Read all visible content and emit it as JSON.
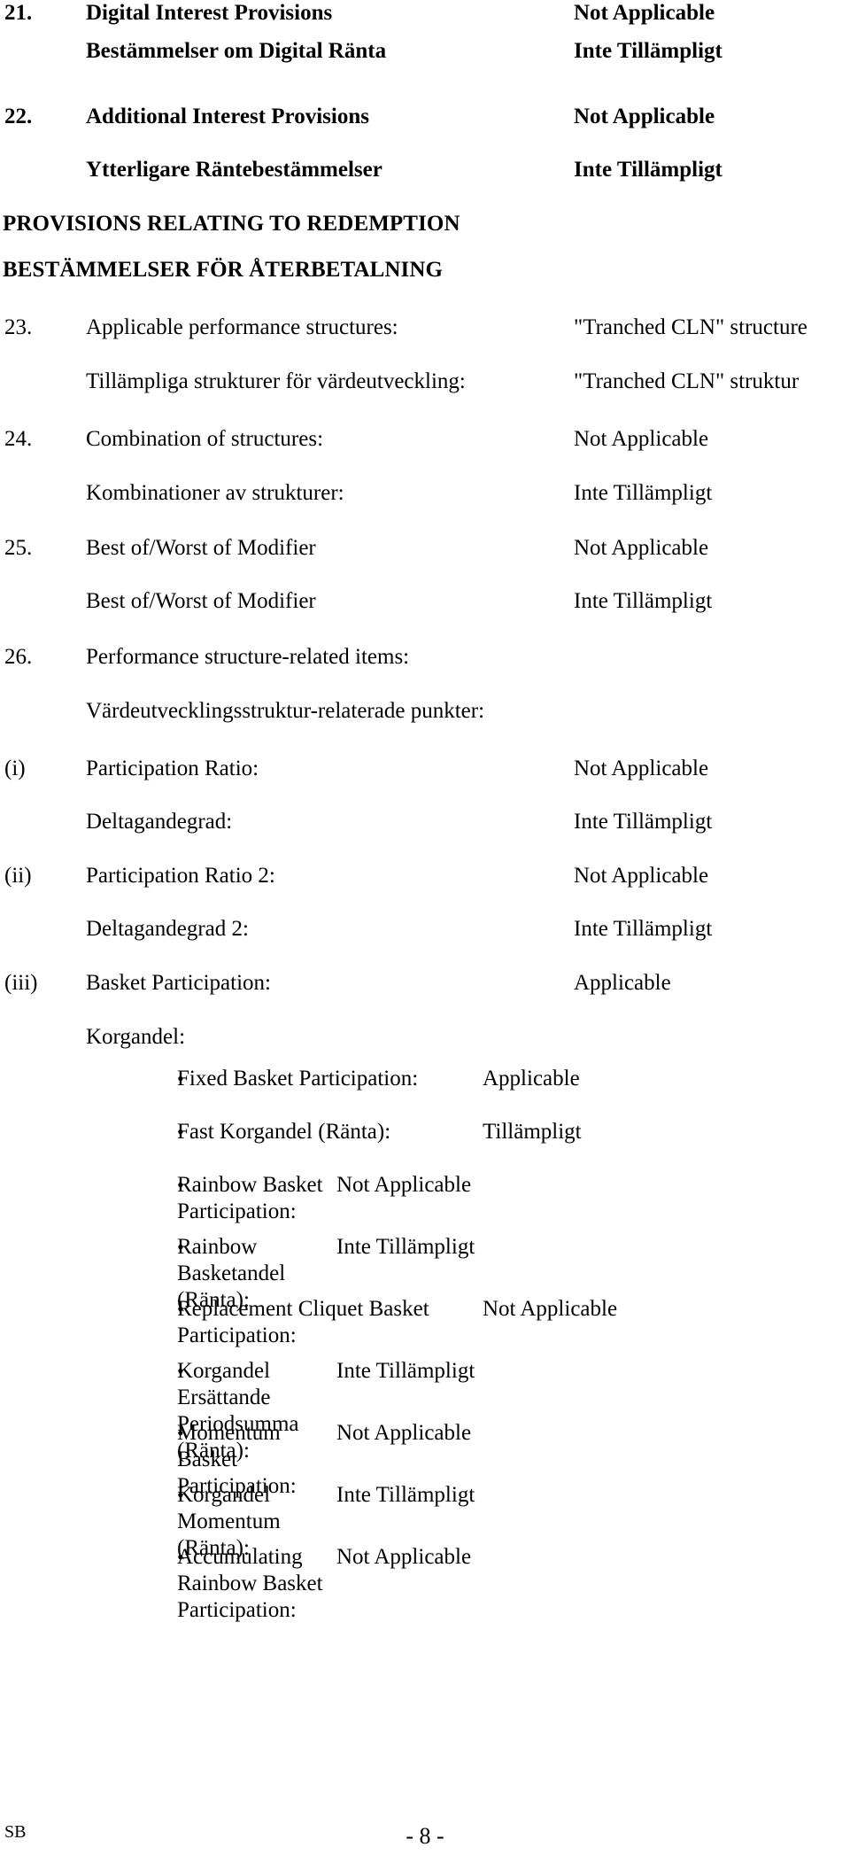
{
  "document": {
    "sections": [
      {
        "number": "21.",
        "label_en": "Digital Interest Provisions",
        "value_en": "Not Applicable",
        "label_sv": "Bestämmelser om Digital Ränta",
        "value_sv": "Inte Tillämpligt"
      },
      {
        "number": "22.",
        "label_en": "Additional Interest Provisions",
        "value_en": "Not Applicable",
        "label_sv": "Ytterligare Räntebestämmelser",
        "value_sv": "Inte Tillämpligt"
      }
    ],
    "headings": {
      "en": "PROVISIONS RELATING TO REDEMPTION",
      "sv": "BESTÄMMELSER FÖR ÅTERBETALNING"
    },
    "items": [
      {
        "number": "23.",
        "label_en": "Applicable performance structures:",
        "value_en": "\"Tranched CLN\" structure",
        "label_sv": "Tillämpliga strukturer för värdeutveckling:",
        "value_sv": "\"Tranched CLN\" struktur"
      },
      {
        "number": "24.",
        "label_en": "Combination of structures:",
        "value_en": "Not Applicable",
        "label_sv": "Kombinationer av strukturer:",
        "value_sv": "Inte Tillämpligt"
      },
      {
        "number": "25.",
        "label_en": "Best of/Worst of Modifier",
        "value_en": "Not Applicable",
        "label_sv": "Best of/Worst of Modifier",
        "value_sv": "Inte Tillämpligt"
      },
      {
        "number": "26.",
        "label_en": "Performance structure-related items:",
        "value_en": "",
        "label_sv": "Värdeutvecklingsstruktur-relaterade punkter:",
        "value_sv": ""
      }
    ],
    "subitems": [
      {
        "number": "(i)",
        "label_en": "Participation Ratio:",
        "value_en": "Not Applicable",
        "label_sv": "Deltagandegrad:",
        "value_sv": "Inte Tillämpligt"
      },
      {
        "number": "(ii)",
        "label_en": "Participation Ratio 2:",
        "value_en": "Not Applicable",
        "label_sv": "Deltagandegrad 2:",
        "value_sv": "Inte Tillämpligt"
      },
      {
        "number": "(iii)",
        "label_en": "Basket Participation:",
        "value_en": "Applicable",
        "label_sv": "Korgandel:",
        "value_sv": ""
      }
    ],
    "bullets": [
      {
        "marker": "•",
        "text": "Fixed Basket Participation:",
        "value": "Applicable"
      },
      {
        "marker": "•",
        "text": "Fast Korgandel (Ränta):",
        "value": "Tillämpligt"
      },
      {
        "marker": "•",
        "text": "Rainbow Basket Participation:",
        "value": "Not Applicable"
      },
      {
        "marker": "•",
        "text": "Rainbow Basketandel (Ränta):",
        "value": "Inte Tillämpligt"
      },
      {
        "marker": "•",
        "text": "Replacement Cliquet Basket Participation:",
        "value": "Not Applicable"
      },
      {
        "marker": "•",
        "text": "Korgandel Ersättande Periodsumma (Ränta):",
        "value": "Inte Tillämpligt"
      },
      {
        "marker": "•",
        "text": "Momentum Basket Participation:",
        "value": "Not Applicable"
      },
      {
        "marker": "•",
        "text": "Korgandel Momentum (Ränta):",
        "value": "Inte Tillämpligt"
      },
      {
        "marker": "•",
        "text": "Accumulating Rainbow Basket Participation:",
        "value": "Not Applicable"
      }
    ],
    "footer": {
      "left": "SB",
      "page": "- 8 -"
    }
  }
}
